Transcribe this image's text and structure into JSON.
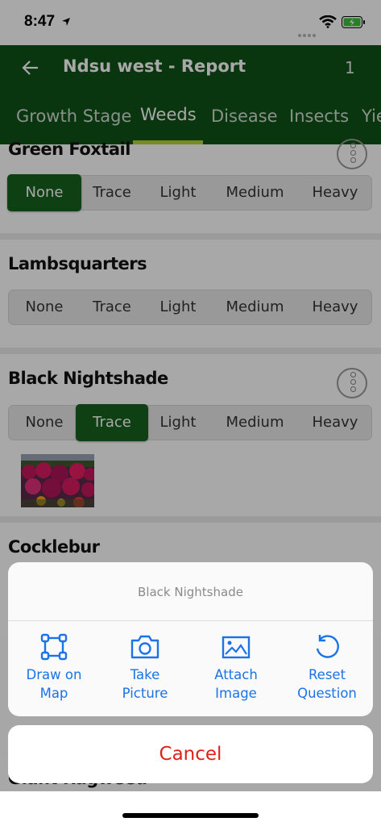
{
  "status": {
    "time": "8:47"
  },
  "header": {
    "title": "Ndsu west - Report",
    "counter": "1",
    "tabs": [
      "Growth Stage",
      "Weeds",
      "Disease",
      "Insects",
      "Yie"
    ],
    "active_tab": "Weeds"
  },
  "questions": [
    {
      "label": "Green Foxtail",
      "selected": "None"
    },
    {
      "label": "Lambsquarters",
      "selected": ""
    },
    {
      "label": "Black Nightshade",
      "selected": "Trace"
    },
    {
      "label": "Cocklebur",
      "selected": ""
    },
    {
      "label": "Giant Ragweed",
      "selected": ""
    }
  ],
  "levels": [
    "None",
    "Trace",
    "Light",
    "Medium",
    "Heavy"
  ],
  "action_sheet": {
    "title": "Black Nightshade",
    "actions": [
      {
        "line1": "Draw on",
        "line2": "Map",
        "icon": "draw-map-icon"
      },
      {
        "line1": "Take",
        "line2": "Picture",
        "icon": "camera-icon"
      },
      {
        "line1": "Attach",
        "line2": "Image",
        "icon": "image-icon"
      },
      {
        "line1": "Reset",
        "line2": "Question",
        "icon": "reset-icon"
      }
    ],
    "cancel": "Cancel"
  },
  "colors": {
    "header": "#0e5218",
    "selected": "#17621f",
    "tab_indicator": "#b8d232",
    "action": "#1b73e8",
    "cancel": "#e0201b"
  }
}
